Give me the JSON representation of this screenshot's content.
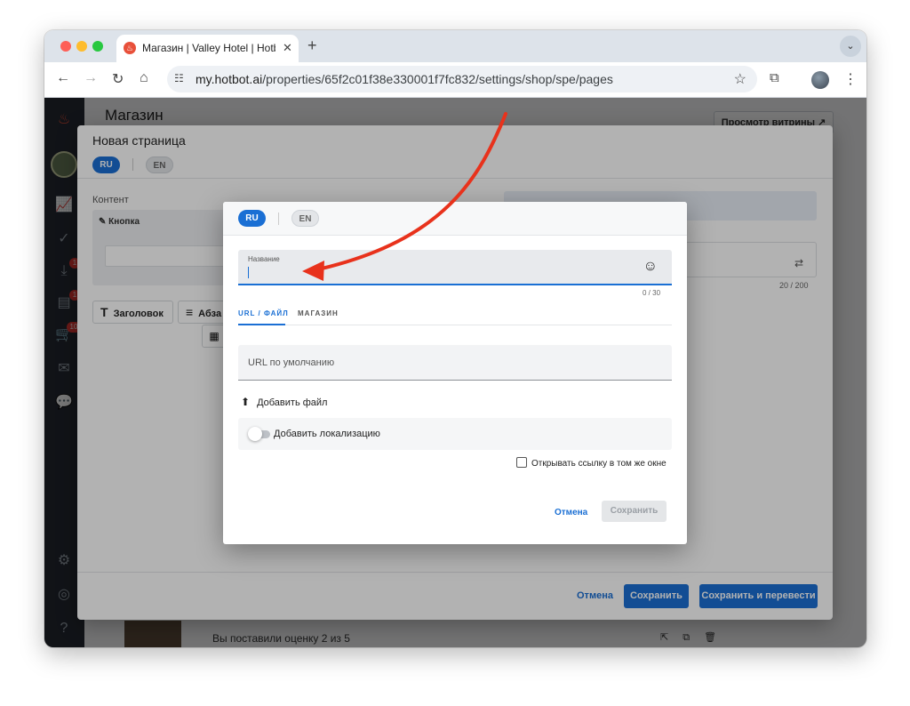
{
  "browser": {
    "tab_title": "Магазин | Valley Hotel | Hotbot",
    "tab_favicon": "hotbot-flame-icon",
    "url_host": "my.hotbot.ai",
    "url_path": "/properties/65f2c01f38e330001f7fc832/settings/shop/spe/pages"
  },
  "page": {
    "title": "Магазин",
    "storefront_button": "Просмотр витрины ↗",
    "list_item_text": "Вы поставили оценку 2 из 5",
    "sidebar_badges": [
      "1",
      "1",
      "10"
    ]
  },
  "dialog_page": {
    "title": "Новая страница",
    "lang_active": "RU",
    "lang_inactive": "EN",
    "content_label": "Контент",
    "button_block_label": "Кнопка",
    "counter": "20 / 200",
    "tool_heading": "Заголовок",
    "tool_paragraph": "Абза",
    "cancel": "Отмена",
    "save": "Сохранить",
    "save_translate": "Сохранить и перевести"
  },
  "dialog_button": {
    "lang_active": "RU",
    "lang_inactive": "EN",
    "name_label": "Название",
    "name_value": "",
    "name_counter": "0 / 30",
    "tab_url": "URL / ФАЙЛ",
    "tab_shop": "МАГАЗИН",
    "url_placeholder": "URL по умолчанию",
    "add_file": "Добавить файл",
    "add_localization": "Добавить локализацию",
    "open_same_window": "Открывать ссылку в том же окне",
    "cancel": "Отмена",
    "save": "Сохранить"
  },
  "colors": {
    "accent": "#1a6fd4",
    "annotation_arrow": "#e8321c"
  }
}
